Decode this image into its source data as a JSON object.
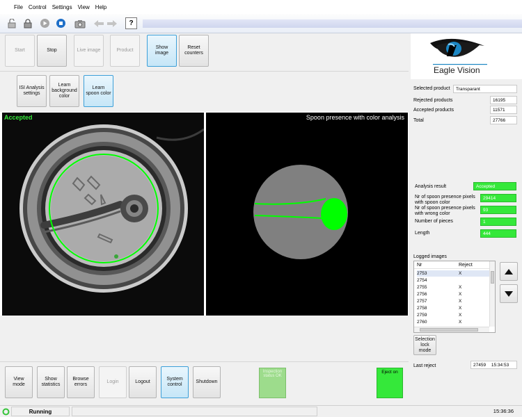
{
  "menu": {
    "items": [
      "File",
      "Control",
      "Settings",
      "View",
      "Help"
    ]
  },
  "toolbar": {
    "icons": [
      "lock-open-icon",
      "lock-icon",
      "play-icon",
      "stop-icon",
      "camera-icon",
      "arrow-left-icon",
      "arrow-right-icon",
      "help-icon"
    ],
    "help_glyph": "?"
  },
  "controls": {
    "start": "Start",
    "stop": "Stop",
    "live_image": "Live image",
    "product": "Product",
    "show_image": "Show image",
    "reset_counters": "Reset counters"
  },
  "analysis_buttons": {
    "isi_settings": "ISI Analysis settings",
    "learn_background": "Learn background color",
    "learn_spoon": "Learn spoon color"
  },
  "logo": {
    "text": "Eagle Vision"
  },
  "stats": {
    "selected_product_label": "Selected product",
    "selected_product": "Transparant",
    "rejected_label": "Rejected products",
    "rejected": "16195",
    "accepted_label": "Accepted products",
    "accepted": "11571",
    "total_label": "Total",
    "total": "27766"
  },
  "images": {
    "left_status": "Accepted",
    "right_title": "Spoon presence with color analysis"
  },
  "results": {
    "analysis_result_label": "Analysis result",
    "analysis_result": "Accepted",
    "spoon_pixels_label": "Nr of spoon presence pixels with spoon color",
    "spoon_pixels": "29414",
    "wrong_color_label": "Nr of spoon presence pixels with wrong color",
    "wrong_color": "93",
    "pieces_label": "Number of pieces",
    "pieces": "1",
    "length_label": "Length",
    "length": "444"
  },
  "logged_images": {
    "title": "Logged images",
    "col_nr": "Nr",
    "col_reject": "Reject",
    "rows": [
      {
        "nr": "2753",
        "reject": "X"
      },
      {
        "nr": "2754",
        "reject": ""
      },
      {
        "nr": "2755",
        "reject": "X"
      },
      {
        "nr": "2756",
        "reject": "X"
      },
      {
        "nr": "2757",
        "reject": "X"
      },
      {
        "nr": "2758",
        "reject": "X"
      },
      {
        "nr": "2759",
        "reject": "X"
      },
      {
        "nr": "2760",
        "reject": "X"
      }
    ],
    "selection_lock": "Selection lock mode"
  },
  "last_reject": {
    "label": "Last reject",
    "number": "27459",
    "time": "15:34:53"
  },
  "bottom": {
    "view_mode": "View mode",
    "show_statistics": "Show statistics",
    "browse_errors": "Browse errors",
    "login": "Login",
    "logout": "Logout",
    "system_control": "System control",
    "shutdown": "Shutdown",
    "inspection_status": "Inspection status OK",
    "eject_on": "Eject on"
  },
  "status": {
    "state": "Running",
    "clock": "15:36:36"
  },
  "colors": {
    "accent_green": "#35e83a",
    "overlay_green": "#00ff00",
    "active_blue": "#3c9fd8"
  }
}
